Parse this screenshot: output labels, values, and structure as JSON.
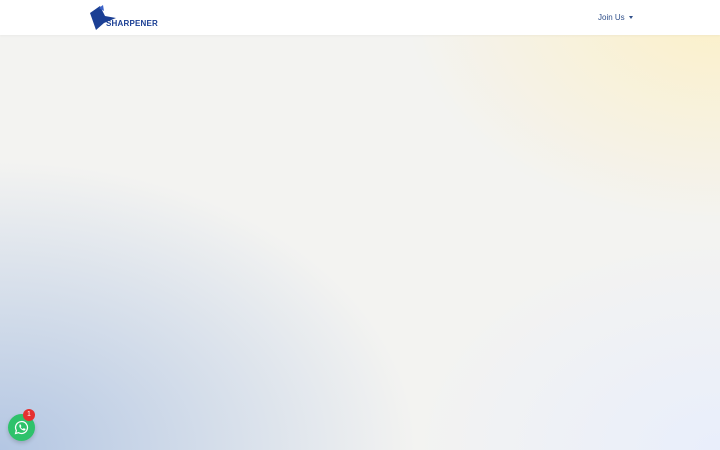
{
  "header": {
    "logo_text": "SHARPENER",
    "join_menu_label": "Join Us"
  },
  "chat_widget": {
    "icon": "whatsapp-icon",
    "badge_count": "1"
  },
  "colors": {
    "brand": "#1b3f94",
    "whatsapp": "#2ec26b",
    "badge": "#e53030"
  }
}
